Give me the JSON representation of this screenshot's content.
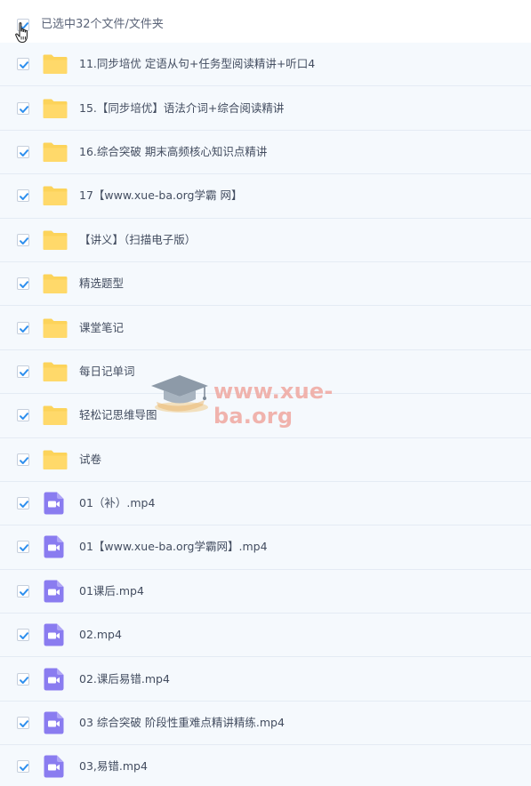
{
  "header": {
    "selection_label": "已选中32个文件/文件夹"
  },
  "watermark": {
    "text": "www.xue-ba.org"
  },
  "colors": {
    "check": "#2e8fee",
    "folder": "#fcd35a",
    "video": "#8a7cf0",
    "row_bg": "#f5f9fd"
  },
  "items": [
    {
      "name": "11.同步培优 定语从句+任务型阅读精讲+听口4",
      "type": "folder"
    },
    {
      "name": "15.【同步培优】语法介词+综合阅读精讲",
      "type": "folder"
    },
    {
      "name": "16.综合突破 期末高频核心知识点精讲",
      "type": "folder"
    },
    {
      "name": "17【www.xue-ba.org学霸 网】",
      "type": "folder"
    },
    {
      "name": "【讲义】（扫描电子版）",
      "type": "folder"
    },
    {
      "name": "精选题型",
      "type": "folder"
    },
    {
      "name": "课堂笔记",
      "type": "folder"
    },
    {
      "name": "每日记单词",
      "type": "folder"
    },
    {
      "name": "轻松记思维导图",
      "type": "folder"
    },
    {
      "name": "试卷",
      "type": "folder"
    },
    {
      "name": "01（补）.mp4",
      "type": "video"
    },
    {
      "name": "01【www.xue-ba.org学霸网】.mp4",
      "type": "video"
    },
    {
      "name": "01课后.mp4",
      "type": "video"
    },
    {
      "name": "02.mp4",
      "type": "video"
    },
    {
      "name": "02.课后易错.mp4",
      "type": "video"
    },
    {
      "name": "03 综合突破 阶段性重难点精讲精练.mp4",
      "type": "video"
    },
    {
      "name": "03,易错.mp4",
      "type": "video"
    }
  ]
}
